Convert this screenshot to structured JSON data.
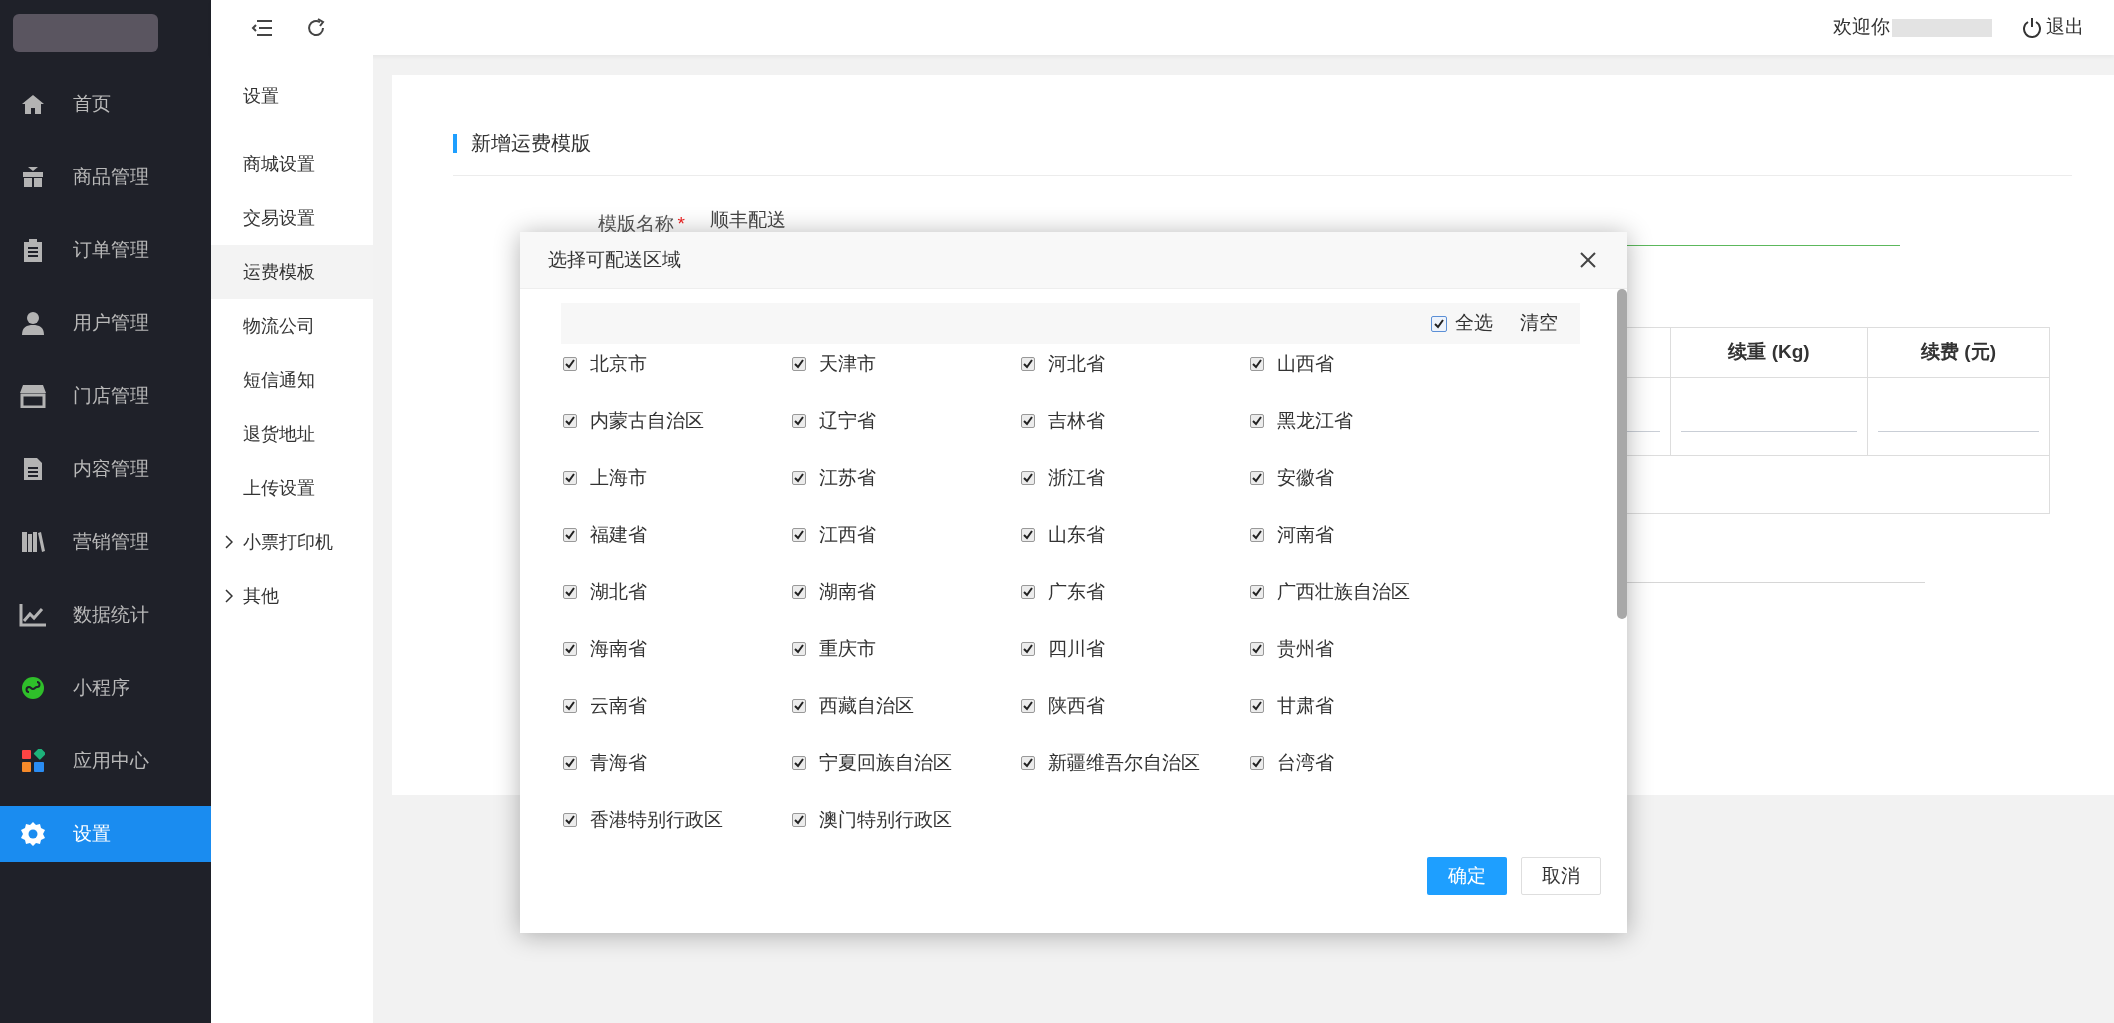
{
  "sidebar": {
    "items": [
      {
        "label": "首页",
        "selected": false
      },
      {
        "label": "商品管理",
        "selected": false
      },
      {
        "label": "订单管理",
        "selected": false
      },
      {
        "label": "用户管理",
        "selected": false
      },
      {
        "label": "门店管理",
        "selected": false
      },
      {
        "label": "内容管理",
        "selected": false
      },
      {
        "label": "营销管理",
        "selected": false
      },
      {
        "label": "数据统计",
        "selected": false
      },
      {
        "label": "小程序",
        "selected": false
      },
      {
        "label": "应用中心",
        "selected": false
      },
      {
        "label": "设置",
        "selected": true
      }
    ]
  },
  "top_bar": {
    "welcome": "欢迎你",
    "logout": "退出"
  },
  "submenu": {
    "title": "设置",
    "items": [
      {
        "label": "商城设置",
        "selected": false,
        "expandable": false
      },
      {
        "label": "交易设置",
        "selected": false,
        "expandable": false
      },
      {
        "label": "运费模板",
        "selected": true,
        "expandable": false
      },
      {
        "label": "物流公司",
        "selected": false,
        "expandable": false
      },
      {
        "label": "短信通知",
        "selected": false,
        "expandable": false
      },
      {
        "label": "退货地址",
        "selected": false,
        "expandable": false
      },
      {
        "label": "上传设置",
        "selected": false,
        "expandable": false
      },
      {
        "label": "小票打印机",
        "selected": false,
        "expandable": true
      },
      {
        "label": "其他",
        "selected": false,
        "expandable": true
      }
    ]
  },
  "page": {
    "section_title": "新增运费模版",
    "template_name": {
      "label": "模版名称",
      "required_mark": "*",
      "value": "顺丰配送"
    },
    "table": {
      "columns": [
        "续重 (Kg)",
        "续费 (元)"
      ]
    }
  },
  "dialog": {
    "title": "选择可配送区域",
    "select_all": {
      "label": "全选",
      "checked": true
    },
    "clear": "清空",
    "regions": [
      {
        "label": "北京市",
        "checked": true
      },
      {
        "label": "天津市",
        "checked": true
      },
      {
        "label": "河北省",
        "checked": true
      },
      {
        "label": "山西省",
        "checked": true
      },
      {
        "label": "内蒙古自治区",
        "checked": true
      },
      {
        "label": "辽宁省",
        "checked": true
      },
      {
        "label": "吉林省",
        "checked": true
      },
      {
        "label": "黑龙江省",
        "checked": true
      },
      {
        "label": "上海市",
        "checked": true
      },
      {
        "label": "江苏省",
        "checked": true
      },
      {
        "label": "浙江省",
        "checked": true
      },
      {
        "label": "安徽省",
        "checked": true
      },
      {
        "label": "福建省",
        "checked": true
      },
      {
        "label": "江西省",
        "checked": true
      },
      {
        "label": "山东省",
        "checked": true
      },
      {
        "label": "河南省",
        "checked": true
      },
      {
        "label": "湖北省",
        "checked": true
      },
      {
        "label": "湖南省",
        "checked": true
      },
      {
        "label": "广东省",
        "checked": true
      },
      {
        "label": "广西壮族自治区",
        "checked": true
      },
      {
        "label": "海南省",
        "checked": true
      },
      {
        "label": "重庆市",
        "checked": true
      },
      {
        "label": "四川省",
        "checked": true
      },
      {
        "label": "贵州省",
        "checked": true
      },
      {
        "label": "云南省",
        "checked": true
      },
      {
        "label": "西藏自治区",
        "checked": true
      },
      {
        "label": "陕西省",
        "checked": true
      },
      {
        "label": "甘肃省",
        "checked": true
      },
      {
        "label": "青海省",
        "checked": true
      },
      {
        "label": "宁夏回族自治区",
        "checked": true
      },
      {
        "label": "新疆维吾尔自治区",
        "checked": true
      },
      {
        "label": "台湾省",
        "checked": true
      },
      {
        "label": "香港特别行政区",
        "checked": true
      },
      {
        "label": "澳门特别行政区",
        "checked": true
      }
    ],
    "confirm": "确定",
    "cancel": "取消"
  }
}
